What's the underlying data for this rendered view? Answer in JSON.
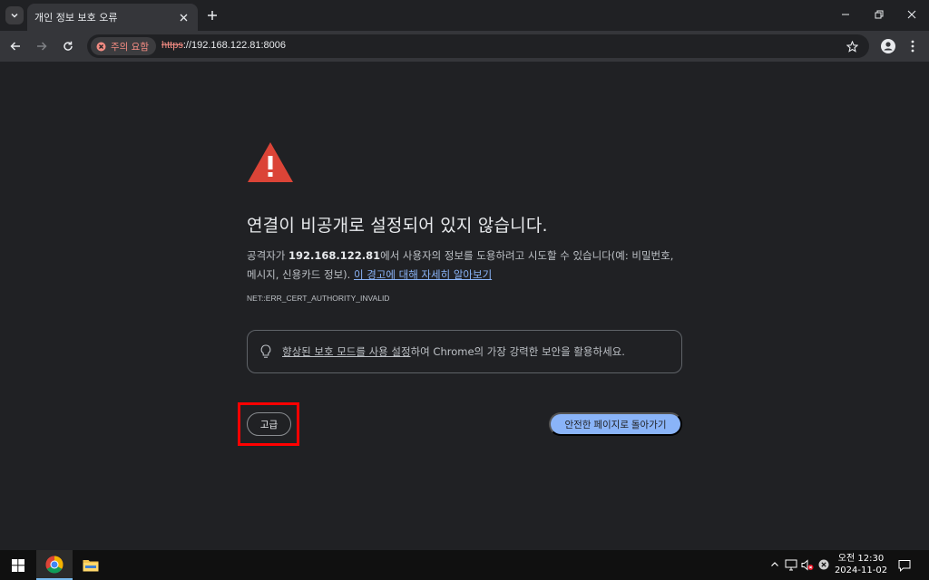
{
  "browser": {
    "tab_title": "개인 정보 보호 오류",
    "security_chip": "주의 요함",
    "url_scheme": "https",
    "url_rest": "://192.168.122.81:8006"
  },
  "page": {
    "heading": "연결이 비공개로 설정되어 있지 않습니다.",
    "desc_prefix": "공격자가 ",
    "desc_host": "192.168.122.81",
    "desc_middle": "에서 사용자의 정보를 도용하려고 시도할 수 있습니다(예: 비밀번호, 메시지, 신용카드 정보). ",
    "desc_link": "이 경고에 대해 자세히 알아보기",
    "error_code": "NET::ERR_CERT_AUTHORITY_INVALID",
    "promo_link": "향상된 보호 모드를 사용 설정",
    "promo_rest": "하여 Chrome의 가장 강력한 보안을 활용하세요.",
    "advanced_button": "고급",
    "back_button": "안전한 페이지로 돌아가기"
  },
  "taskbar": {
    "time": "오전 12:30",
    "date": "2024-11-02"
  },
  "colors": {
    "warning_red": "#db4437",
    "link_blue": "#8ab4f8",
    "highlight_red": "#ff0000"
  }
}
